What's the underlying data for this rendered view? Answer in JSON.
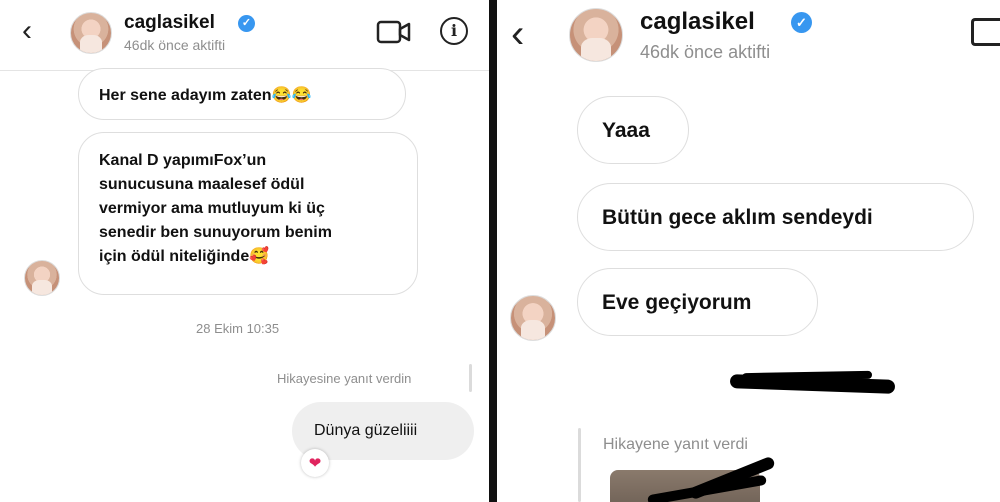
{
  "left_chat": {
    "username": "caglasikel",
    "status": "46dk önce aktifti",
    "messages": [
      {
        "text": "Her sene  adayım zaten😂😂"
      },
      {
        "lines": [
          "Kanal D yapımıFox’un",
          "sunucusuna maalesef ödül",
          "vermiyor ama mutluyum ki üç",
          "senedir ben sunuyorum benim",
          "için ödül niteliğinde🥰"
        ]
      }
    ],
    "timestamp": "28 Ekim 10:35",
    "reply_note": "Hikayesine yanıt verdin",
    "outgoing": "Dünya güzeliiii",
    "reaction": "❤"
  },
  "right_chat": {
    "username": "caglasikel",
    "status": "46dk önce aktifti",
    "messages": [
      "Yaaa",
      "Bütün gece aklım sendeydi",
      "Eve geçiyorum"
    ],
    "reply_note": "Hikayene yanıt verdi"
  },
  "icons": {
    "back": "back-chevron-icon",
    "video": "video-call-icon",
    "info": "info-icon",
    "verified": "verified-badge-icon"
  },
  "colors": {
    "verified": "#3897f0",
    "secondary_text": "#8e8e8e",
    "bubble_border": "#dedede",
    "outgoing_bubble": "#efefef"
  }
}
